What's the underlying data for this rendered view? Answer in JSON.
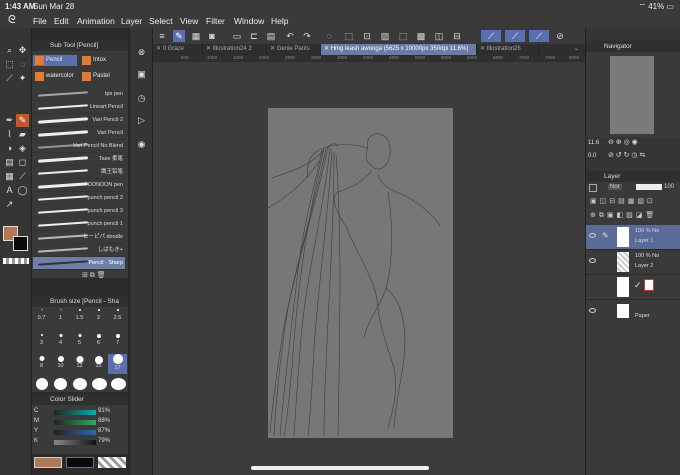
{
  "status": {
    "time": "1:43 AM",
    "date": "Sun Mar 28",
    "battery": "41%"
  },
  "menu": [
    "File",
    "Edit",
    "Animation",
    "Layer",
    "Select",
    "View",
    "Filter",
    "Window",
    "Help"
  ],
  "subtool": {
    "title": "Sub Tool [Pencil]",
    "categories": [
      "Pencil",
      "Intox",
      "watercolor",
      "Pastel"
    ],
    "brushes": [
      "tps pen",
      "Lineart Pencil",
      "Vari Pencil 2",
      "Vari Pencil",
      "Vari Pencil No Blend",
      "Taxe 柔笔",
      "鹰王铅笔",
      "DONDON pen",
      "punch pencil 2",
      "punch pencil 3",
      "punch pencil 1",
      "ヒーピパ doodle",
      "しばもき+",
      "Pencil - Sharp"
    ]
  },
  "brushsize": {
    "title": "Brush size [Pencil - Sha",
    "sizes": [
      "0.7",
      "1",
      "1.5",
      "2",
      "2.5",
      "3",
      "4",
      "5",
      "6",
      "7",
      "8",
      "10",
      "12",
      "15",
      "17"
    ]
  },
  "colorslider": {
    "title": "Color Slider",
    "channels": [
      {
        "label": "C",
        "value": "91%",
        "color": "#3aa0a0"
      },
      {
        "label": "M",
        "value": "88%",
        "color": "#a03a7a"
      },
      {
        "label": "Y",
        "value": "87%",
        "color": "#a0a03a"
      },
      {
        "label": "K",
        "value": "79%",
        "color": "#555555"
      }
    ],
    "main_color": "#b07a55",
    "sub_color": "#0a0a0a"
  },
  "tabs": [
    "0 Graze",
    "Illustration24 2",
    "Genie Pants",
    "Hmg leash awooga (5625 x 10000px 350dpi 11.6%)",
    "Illustration26"
  ],
  "ruler_ticks": [
    "500",
    "1000",
    "1500",
    "2000",
    "2500",
    "3000",
    "3500",
    "4000",
    "4500",
    "5000",
    "5500",
    "6000",
    "6500",
    "7000",
    "7500",
    "8000"
  ],
  "navigator": {
    "title": "Navigator",
    "zoom": "11.6",
    "rotation": "0.0"
  },
  "layers": {
    "title": "Layer",
    "blend": "Nor",
    "opacity": "100",
    "items": [
      {
        "opacity": "100 % No",
        "name": "Layer 1"
      },
      {
        "opacity": "100 % No",
        "name": "Layer 2"
      },
      {
        "opacity": "",
        "name": ""
      },
      {
        "opacity": "",
        "name": "Paper"
      }
    ]
  }
}
